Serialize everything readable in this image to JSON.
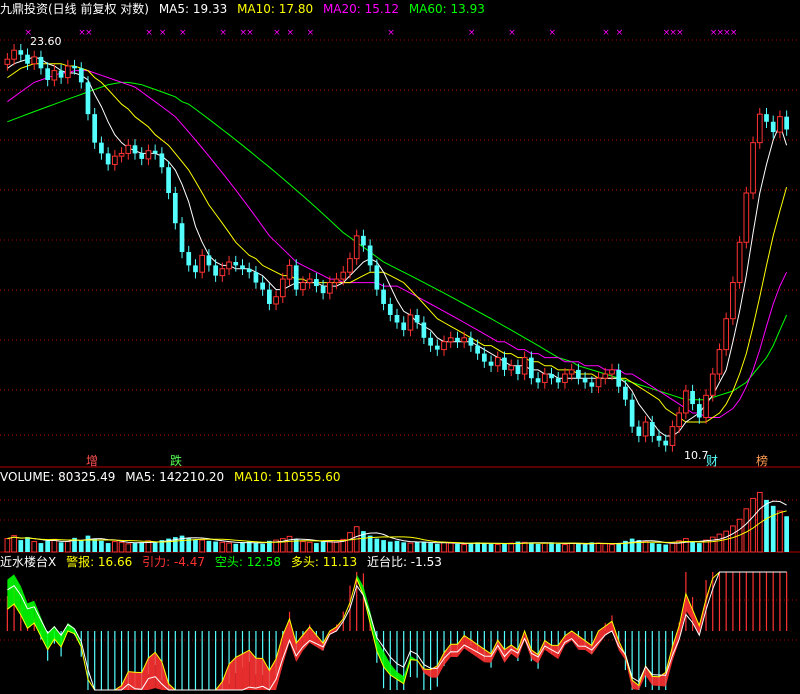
{
  "header": {
    "title": "九鼎投资(日线 前复权 对数)",
    "ma5": "MA5: 19.33",
    "ma10": "MA10: 17.80",
    "ma20": "MA20: 15.12",
    "ma60": "MA60: 13.93"
  },
  "volume_header": {
    "volume": "VOLUME: 80325.49",
    "ma5": "MA5: 142210.20",
    "ma10": "MA10: 110555.60"
  },
  "indicator_header": {
    "name": "近水楼台X",
    "alarm": "警报: 16.66",
    "pull": "引力: -4.47",
    "short": "空头: 12.58",
    "long": "多头: 11.13",
    "ratio": "近台比: -1.53"
  },
  "annotations": {
    "high_label": "23.60",
    "low_label": "10.7",
    "mark_zeng": "增",
    "mark_die": "跌",
    "mark_cai": "财",
    "mark_bang": "榜"
  },
  "colors": {
    "background": "#000000",
    "up_candle": "#ff3232",
    "down_candle": "#54ffff",
    "ma5": "#ffffff",
    "ma10": "#ffff00",
    "ma20": "#ff00ff",
    "ma60": "#00ff00",
    "grid": "#b40000",
    "pull": "#ff3232",
    "short": "#00ff00",
    "long": "#ffff00",
    "ratio": "#ffffff"
  },
  "chart_data": {
    "type": "candlestick",
    "scale": "log",
    "ylim": [
      10.5,
      24.5
    ],
    "close": [
      22.8,
      23.2,
      23.0,
      22.6,
      22.9,
      22.4,
      21.9,
      22.3,
      22.0,
      22.5,
      22.4,
      21.8,
      20.5,
      19.4,
      19.0,
      18.6,
      18.9,
      19.0,
      19.3,
      19.0,
      18.8,
      19.1,
      19.0,
      18.5,
      17.6,
      16.6,
      15.7,
      15.3,
      15.1,
      15.6,
      15.3,
      15.0,
      15.2,
      15.4,
      15.3,
      15.2,
      15.1,
      14.8,
      14.6,
      14.2,
      14.4,
      14.9,
      15.3,
      14.6,
      14.8,
      14.9,
      14.7,
      14.5,
      14.8,
      14.9,
      15.1,
      15.5,
      16.2,
      15.9,
      15.3,
      14.6,
      14.2,
      13.9,
      13.7,
      13.5,
      13.9,
      13.7,
      13.3,
      13.1,
      13.0,
      13.2,
      13.3,
      13.2,
      13.3,
      13.1,
      12.9,
      12.7,
      12.6,
      12.8,
      12.5,
      12.6,
      12.4,
      12.8,
      12.3,
      12.2,
      12.4,
      12.3,
      12.2,
      12.4,
      12.5,
      12.3,
      12.2,
      12.1,
      12.3,
      12.4,
      12.5,
      12.1,
      11.8,
      11.2,
      11.0,
      11.3,
      11.0,
      10.9,
      10.8,
      11.2,
      11.5,
      12.0,
      11.7,
      11.4,
      11.9,
      12.4,
      13.0,
      13.8,
      14.8,
      16.0,
      17.6,
      19.4,
      20.5,
      20.2,
      19.8,
      20.4,
      19.9
    ],
    "ma5": [
      22.4,
      22.6,
      22.7,
      22.8,
      22.9,
      22.8,
      22.6,
      22.5,
      22.3,
      22.2,
      22.2,
      22.1,
      21.9,
      21.3,
      20.8,
      20.2,
      19.7,
      19.4,
      19.2,
      19.1,
      19.0,
      19.0,
      19.0,
      18.9,
      18.7,
      18.4,
      17.9,
      17.3,
      16.5,
      16.0,
      15.6,
      15.4,
      15.3,
      15.3,
      15.2,
      15.2,
      15.2,
      15.1,
      15.0,
      14.8,
      14.6,
      14.6,
      14.7,
      14.8,
      14.8,
      14.8,
      14.8,
      14.7,
      14.7,
      14.7,
      14.8,
      15.0,
      15.2,
      15.4,
      15.5,
      15.4,
      15.1,
      14.7,
      14.3,
      14.0,
      13.9,
      13.7,
      13.6,
      13.5,
      13.3,
      13.2,
      13.2,
      13.2,
      13.2,
      13.2,
      13.1,
      13.0,
      12.9,
      12.8,
      12.7,
      12.6,
      12.6,
      12.6,
      12.5,
      12.5,
      12.4,
      12.4,
      12.3,
      12.3,
      12.3,
      12.3,
      12.3,
      12.3,
      12.3,
      12.3,
      12.3,
      12.3,
      12.2,
      12.0,
      11.7,
      11.5,
      11.3,
      11.1,
      11.0,
      11.0,
      11.1,
      11.3,
      11.4,
      11.5,
      11.7,
      11.9,
      12.2,
      12.5,
      13.2,
      14.0,
      15.0,
      16.3,
      17.6,
      18.6,
      19.5,
      20.1,
      19.3
    ],
    "ma10": [
      22.0,
      22.2,
      22.4,
      22.5,
      22.6,
      22.6,
      22.6,
      22.6,
      22.6,
      22.5,
      22.5,
      22.4,
      22.3,
      22.0,
      21.8,
      21.5,
      21.2,
      20.9,
      20.7,
      20.4,
      20.2,
      20.0,
      19.7,
      19.5,
      19.3,
      19.0,
      18.7,
      18.4,
      18.0,
      17.6,
      17.2,
      16.9,
      16.6,
      16.3,
      16.0,
      15.8,
      15.6,
      15.5,
      15.3,
      15.2,
      15.1,
      15.0,
      15.0,
      14.9,
      14.9,
      14.8,
      14.8,
      14.8,
      14.8,
      14.8,
      14.8,
      14.8,
      14.9,
      15.0,
      15.1,
      15.1,
      15.1,
      15.0,
      14.9,
      14.8,
      14.6,
      14.4,
      14.2,
      14.0,
      13.8,
      13.7,
      13.6,
      13.5,
      13.4,
      13.3,
      13.2,
      13.1,
      13.1,
      13.0,
      12.9,
      12.9,
      12.8,
      12.8,
      12.7,
      12.7,
      12.6,
      12.6,
      12.5,
      12.5,
      12.5,
      12.4,
      12.4,
      12.4,
      12.3,
      12.3,
      12.3,
      12.3,
      12.3,
      12.2,
      12.1,
      12.0,
      11.9,
      11.8,
      11.6,
      11.5,
      11.4,
      11.3,
      11.3,
      11.3,
      11.3,
      11.4,
      11.5,
      11.7,
      12.0,
      12.4,
      12.9,
      13.6,
      14.4,
      15.3,
      16.2,
      17.0,
      17.8
    ],
    "ma20": [
      21.0,
      21.2,
      21.4,
      21.6,
      21.8,
      21.9,
      22.0,
      22.1,
      22.2,
      22.2,
      22.3,
      22.3,
      22.3,
      22.2,
      22.1,
      22.0,
      21.9,
      21.8,
      21.7,
      21.6,
      21.4,
      21.2,
      21.0,
      20.8,
      20.6,
      20.4,
      20.1,
      19.8,
      19.5,
      19.2,
      18.9,
      18.6,
      18.3,
      18.0,
      17.7,
      17.4,
      17.1,
      16.8,
      16.5,
      16.2,
      16.0,
      15.8,
      15.6,
      15.4,
      15.3,
      15.2,
      15.1,
      15.0,
      14.9,
      14.9,
      14.8,
      14.8,
      14.8,
      14.8,
      14.8,
      14.8,
      14.7,
      14.7,
      14.7,
      14.6,
      14.5,
      14.4,
      14.3,
      14.2,
      14.1,
      14.0,
      13.9,
      13.8,
      13.7,
      13.6,
      13.5,
      13.4,
      13.3,
      13.2,
      13.2,
      13.1,
      13.0,
      13.0,
      12.9,
      12.9,
      12.8,
      12.8,
      12.8,
      12.7,
      12.7,
      12.7,
      12.6,
      12.6,
      12.6,
      12.5,
      12.5,
      12.5,
      12.4,
      12.4,
      12.3,
      12.2,
      12.1,
      12.0,
      11.9,
      11.8,
      11.7,
      11.6,
      11.5,
      11.5,
      11.4,
      11.4,
      11.4,
      11.5,
      11.6,
      11.8,
      12.1,
      12.5,
      13.0,
      13.6,
      14.2,
      14.7,
      15.1
    ],
    "ma60": [
      20.2,
      20.3,
      20.4,
      20.5,
      20.6,
      20.7,
      20.8,
      20.9,
      21.0,
      21.1,
      21.2,
      21.3,
      21.4,
      21.5,
      21.6,
      21.7,
      21.75,
      21.8,
      21.8,
      21.75,
      21.7,
      21.6,
      21.5,
      21.4,
      21.3,
      21.2,
      21.0,
      20.9,
      20.7,
      20.5,
      20.3,
      20.1,
      19.9,
      19.7,
      19.5,
      19.3,
      19.1,
      18.9,
      18.7,
      18.5,
      18.3,
      18.1,
      17.9,
      17.7,
      17.5,
      17.3,
      17.1,
      16.9,
      16.7,
      16.5,
      16.3,
      16.15,
      16.0,
      15.85,
      15.7,
      15.55,
      15.4,
      15.3,
      15.2,
      15.1,
      15.0,
      14.9,
      14.8,
      14.7,
      14.6,
      14.5,
      14.4,
      14.3,
      14.2,
      14.1,
      14.0,
      13.9,
      13.8,
      13.7,
      13.6,
      13.5,
      13.4,
      13.3,
      13.2,
      13.1,
      13.0,
      12.9,
      12.8,
      12.75,
      12.7,
      12.6,
      12.55,
      12.5,
      12.45,
      12.4,
      12.35,
      12.3,
      12.25,
      12.2,
      12.15,
      12.1,
      12.05,
      12.0,
      11.95,
      11.9,
      11.85,
      11.8,
      11.8,
      11.8,
      11.8,
      11.85,
      11.9,
      11.95,
      12.0,
      12.1,
      12.2,
      12.4,
      12.6,
      12.8,
      13.1,
      13.5,
      13.9
    ],
    "volume": [
      18,
      22,
      16,
      20,
      14,
      12,
      15,
      17,
      13,
      14,
      19,
      16,
      22,
      18,
      15,
      12,
      14,
      13,
      11,
      12,
      13,
      15,
      14,
      16,
      18,
      20,
      22,
      19,
      17,
      16,
      15,
      14,
      13,
      12,
      11,
      13,
      14,
      12,
      11,
      15,
      16,
      18,
      21,
      17,
      14,
      13,
      12,
      15,
      14,
      13,
      17,
      26,
      34,
      28,
      22,
      18,
      16,
      14,
      15,
      13,
      12,
      14,
      13,
      12,
      11,
      13,
      12,
      11,
      10,
      12,
      13,
      12,
      11,
      10,
      11,
      12,
      14,
      13,
      12,
      11,
      12,
      13,
      11,
      10,
      12,
      11,
      10,
      13,
      12,
      11,
      10,
      12,
      15,
      18,
      16,
      14,
      12,
      11,
      10,
      12,
      15,
      18,
      14,
      12,
      16,
      20,
      24,
      28,
      35,
      44,
      58,
      72,
      80,
      70,
      62,
      55,
      48
    ],
    "volume_ylim": [
      0,
      90
    ]
  }
}
